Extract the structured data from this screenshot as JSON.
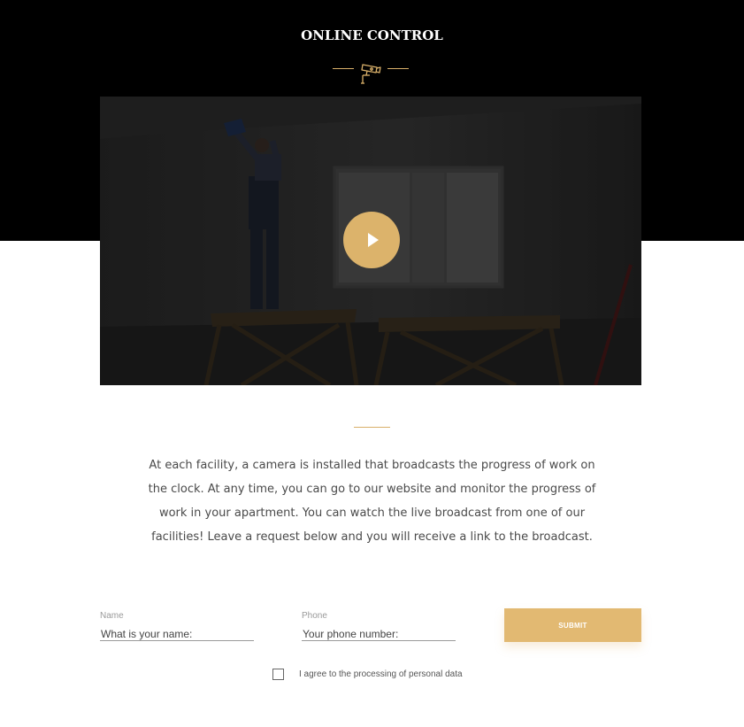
{
  "section": {
    "title": "ONLINE CONTROL"
  },
  "icons": {
    "ornament": "cctv-camera-icon",
    "play": "play-icon"
  },
  "colors": {
    "accent": "#dcb36b",
    "header_background": "#000000",
    "button": "#e2b972"
  },
  "description": "At each facility, a camera is installed that broadcasts the progress of work on the clock. At any time, you can go to our website and monitor the progress of work in your apartment. You can watch the live broadcast from one of our facilities! Leave a request below and you will receive a link to the broadcast.",
  "form": {
    "name_label": "Name",
    "name_placeholder": "What is your name:",
    "phone_label": "Phone",
    "phone_placeholder": "Your phone number:",
    "submit_label": "SUBMIT",
    "consent_label": "I agree to the processing of personal data",
    "consent_checked": false
  }
}
